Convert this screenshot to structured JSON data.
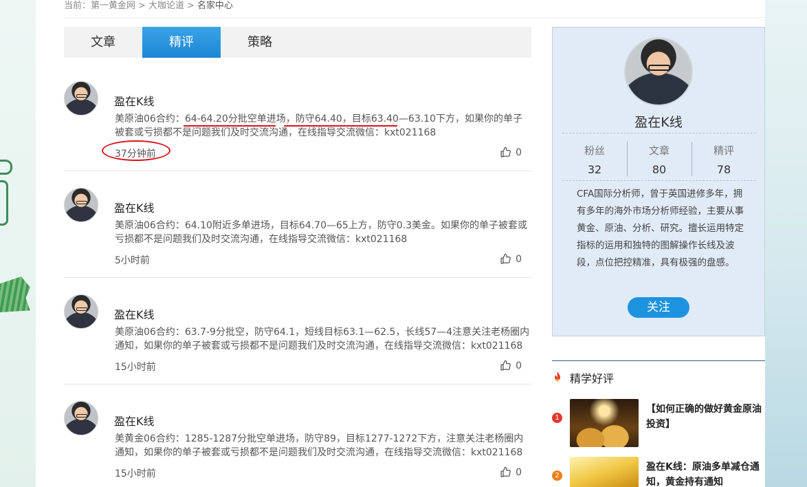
{
  "breadcrumb": {
    "prefix": "当前：",
    "items": [
      "第一黄金网",
      "大咖论道",
      "名家中心"
    ],
    "separator": ">"
  },
  "tabs": [
    {
      "label": "文章",
      "active": false
    },
    {
      "label": "精评",
      "active": true
    },
    {
      "label": "策略",
      "active": false
    }
  ],
  "posts": [
    {
      "author": "盈在K线",
      "body": "美原油06合约：64-64.20分批空单进场，防守64.40，目标63.40—63.10下方，如果你的单子被套或亏损都不是问题我们及时交流沟通，在线指导交流微信：kxt021168",
      "time": "37分钟前",
      "likes": "0"
    },
    {
      "author": "盈在K线",
      "body": "美原油06合约：64.10附近多单进场，目标64.70—65上方，防守0.3美金。如果你的单子被套或亏损都不是问题我们及时交流沟通，在线指导交流微信：kxt021168",
      "time": "5小时前",
      "likes": "0"
    },
    {
      "author": "盈在K线",
      "body": "美原油06合约：63.7-9分批空，防守64.1，短线目标63.1—62.5，长线57—4注意关注老杨圈内通知，如果你的单子被套或亏损都不是问题我们及时交流沟通，在线指导交流微信：kxt021168",
      "time": "15小时前",
      "likes": "0"
    },
    {
      "author": "盈在K线",
      "body": "美黄金06合约：1285-1287分批空单进场，防守89，目标1277-1272下方，注意关注老杨圈内通知，如果你的单子被套或亏损都不是问题我们及时交流沟通，在线指导交流微信：kxt021168",
      "time": "15小时前",
      "likes": "0"
    }
  ],
  "profile": {
    "name": "盈在K线",
    "stats": [
      {
        "label": "粉丝",
        "value": "32"
      },
      {
        "label": "文章",
        "value": "80"
      },
      {
        "label": "精评",
        "value": "78"
      }
    ],
    "bio": "CFA国际分析师，曾于英国进修多年，拥有多年的海外市场分析师经验，主要从事黄金、原油、分析、研究。擅长运用特定指标的运用和独特的图解操作长线及波段，点位把控精准，具有极强的盘感。",
    "follow_label": "关注"
  },
  "hot": {
    "title": "精学好评",
    "items": [
      {
        "num": "1",
        "text": "【如何正确的做好黄金原油投资】"
      },
      {
        "num": "2",
        "text": "盈在K线：原油多单减仓通知，黄金持有通知"
      }
    ]
  },
  "colors": {
    "accent": "#1b86d4",
    "annotation": "#d9141f",
    "card_bg": "#e1ebf7"
  }
}
